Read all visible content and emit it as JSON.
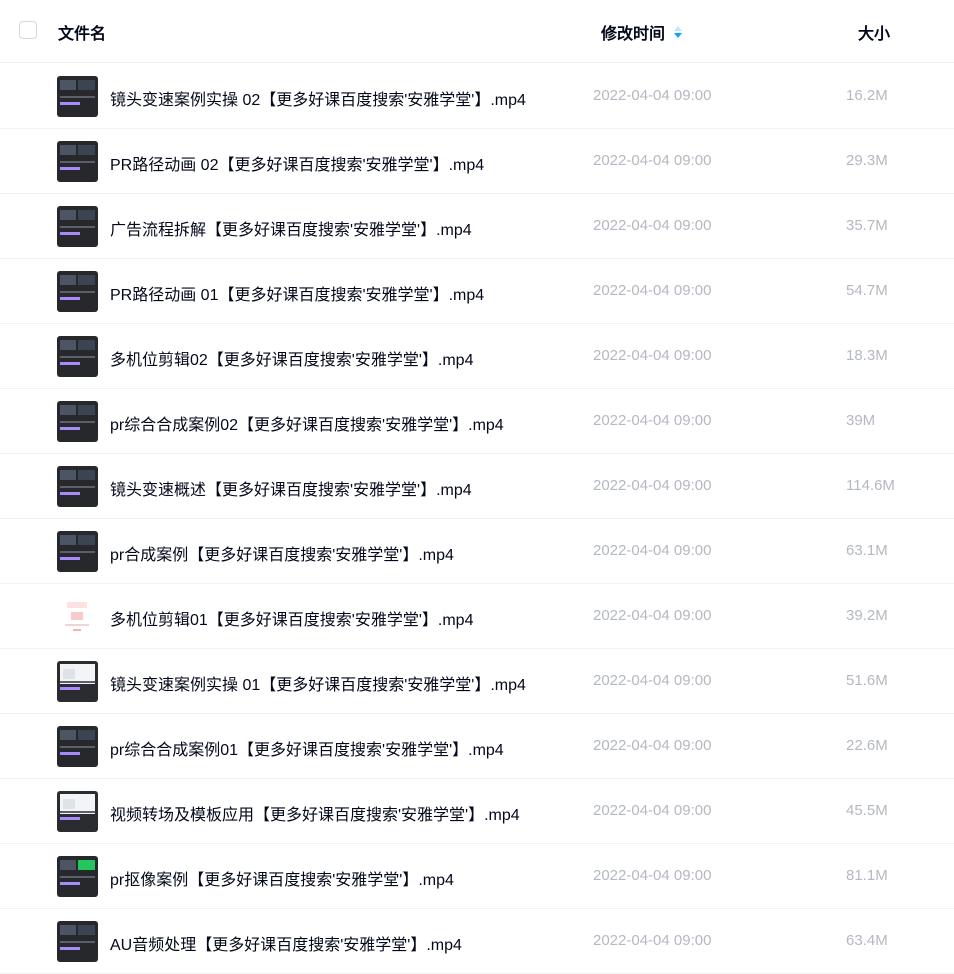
{
  "header": {
    "name_label": "文件名",
    "time_label": "修改时间",
    "size_label": "大小",
    "sort_icon": "sort-updown-icon",
    "accent_color": "#06a7ff"
  },
  "files": [
    {
      "name": "镜头变速案例实操 02【更多好课百度搜索'安雅学堂'】.mp4",
      "time": "2022-04-04 09:00",
      "size": "16.2M"
    },
    {
      "name": "PR路径动画 02【更多好课百度搜索'安雅学堂'】.mp4",
      "time": "2022-04-04 09:00",
      "size": "29.3M"
    },
    {
      "name": "广告流程拆解【更多好课百度搜索'安雅学堂'】.mp4",
      "time": "2022-04-04 09:00",
      "size": "35.7M"
    },
    {
      "name": "PR路径动画 01【更多好课百度搜索'安雅学堂'】.mp4",
      "time": "2022-04-04 09:00",
      "size": "54.7M"
    },
    {
      "name": "多机位剪辑02【更多好课百度搜索'安雅学堂'】.mp4",
      "time": "2022-04-04 09:00",
      "size": "18.3M"
    },
    {
      "name": "pr综合合成案例02【更多好课百度搜索'安雅学堂'】.mp4",
      "time": "2022-04-04 09:00",
      "size": "39M"
    },
    {
      "name": "镜头变速概述【更多好课百度搜索'安雅学堂'】.mp4",
      "time": "2022-04-04 09:00",
      "size": "114.6M"
    },
    {
      "name": "pr合成案例【更多好课百度搜索'安雅学堂'】.mp4",
      "time": "2022-04-04 09:00",
      "size": "63.1M"
    },
    {
      "name": "多机位剪辑01【更多好课百度搜索'安雅学堂'】.mp4",
      "time": "2022-04-04 09:00",
      "size": "39.2M"
    },
    {
      "name": "镜头变速案例实操 01【更多好课百度搜索'安雅学堂'】.mp4",
      "time": "2022-04-04 09:00",
      "size": "51.6M"
    },
    {
      "name": "pr综合合成案例01【更多好课百度搜索'安雅学堂'】.mp4",
      "time": "2022-04-04 09:00",
      "size": "22.6M"
    },
    {
      "name": "视频转场及模板应用【更多好课百度搜索'安雅学堂'】.mp4",
      "time": "2022-04-04 09:00",
      "size": "45.5M"
    },
    {
      "name": "pr抠像案例【更多好课百度搜索'安雅学堂'】.mp4",
      "time": "2022-04-04 09:00",
      "size": "81.1M"
    },
    {
      "name": "AU音频处理【更多好课百度搜索'安雅学堂'】.mp4",
      "time": "2022-04-04 09:00",
      "size": "63.4M"
    }
  ]
}
